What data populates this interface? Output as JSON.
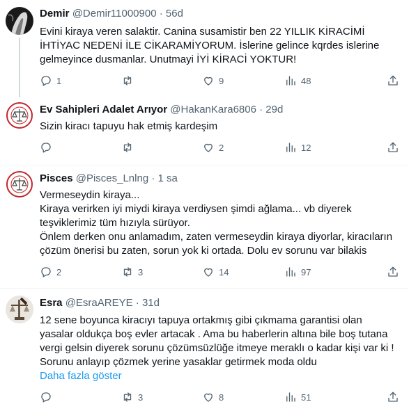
{
  "tweets": [
    {
      "name": "Demir",
      "handle": "@Demir11000900",
      "sep": "·",
      "time": "56d",
      "lines": [
        "Evini kiraya veren salaktir. Canina susamistir ben 22 YILLIK KİRACİMİ",
        "İHTİYAC NEDENİ İLE CİKARAMİYORUM. İslerine gelince kqrdes islerine",
        "gelmeyince dusmanlar. Unutmayi İYİ KİRACİ YOKTUR!"
      ],
      "replies": "1",
      "retweets": "",
      "likes": "9",
      "views": "48"
    },
    {
      "name": "Ev Sahipleri Adalet Arıyor",
      "handle": "@HakanKara6806",
      "sep": "·",
      "time": "29d",
      "lines": [
        "Sizin kiracı tapuyu hak etmiş kardeşim"
      ],
      "replies": "",
      "retweets": "",
      "likes": "2",
      "views": "12"
    },
    {
      "name": "Pisces",
      "handle": "@Pisces_Lnlng",
      "sep": "·",
      "time": "1 sa",
      "lines": [
        "Vermeseydin kiraya...",
        "Kiraya verirken iyi miydi kiraya verdiysen şimdi ağlama... vb diyerek",
        "teşviklerimiz tüm hızıyla sürüyor.",
        "Önlem derken onu anlamadım, zaten vermeseydin kiraya diyorlar, kiracıların",
        "çözüm önerisi bu zaten, sorun yok ki ortada. Dolu ev sorunu var bilakis"
      ],
      "replies": "2",
      "retweets": "3",
      "likes": "14",
      "views": "97"
    },
    {
      "name": "Esra",
      "handle": "@EsraAREYE",
      "sep": "·",
      "time": "31d",
      "lines": [
        "12 sene boyunca kiracıyı tapuya ortakmış gibi çıkmama garantisi olan",
        "yasalar oldukça boş evler artacak . Ama bu haberlerin altına bile boş tutana",
        "vergi gelsin diyerek sorunu çözümsüzlüğe itmeye meraklı o kadar kişi var ki !",
        "Sorunu anlayıp çözmek yerine yasaklar getirmek moda oldu"
      ],
      "show_more": "Daha fazla göster",
      "replies": "",
      "retweets": "3",
      "likes": "8",
      "views": "51"
    }
  ],
  "icons": {
    "reply": "reply-icon",
    "retweet": "retweet-icon",
    "like": "heart-icon",
    "views": "views-icon",
    "share": "share-icon"
  },
  "colors": {
    "text": "#0f1419",
    "secondary": "#536471",
    "link": "#1d9bf0",
    "divider": "#eff3f4",
    "thread_line": "#cfd9de"
  }
}
